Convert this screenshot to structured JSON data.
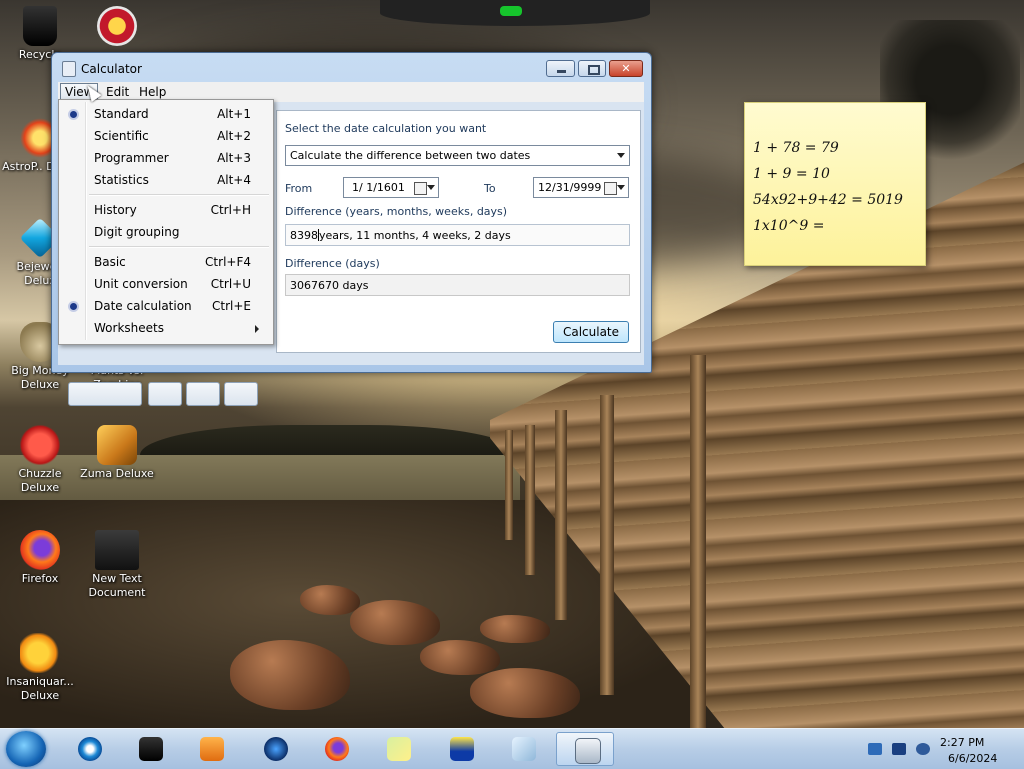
{
  "desktop": {
    "icons": [
      {
        "label": "Recycle"
      },
      {
        "label": "AstroP.. Delux"
      },
      {
        "label": "Bejewe.. Delux"
      },
      {
        "label": "Big Money Deluxe"
      },
      {
        "label": "Plants vs. Zombies"
      },
      {
        "label": "Chuzzle Deluxe"
      },
      {
        "label": "Zuma Deluxe"
      },
      {
        "label": "Firefox"
      },
      {
        "label": "New Text Document"
      },
      {
        "label": "Insaniquar... Deluxe"
      }
    ]
  },
  "sticky": {
    "lines": [
      "1 + 78 = 79",
      "1 + 9 = 10",
      "54x92+9+42 = 5019",
      "1x10^9 ="
    ]
  },
  "calculator": {
    "title": "Calculator",
    "menu": {
      "view": "View",
      "edit": "Edit",
      "help": "Help"
    },
    "view_menu": [
      {
        "label": "Standard",
        "shortcut": "Alt+1"
      },
      {
        "label": "Scientific",
        "shortcut": "Alt+2"
      },
      {
        "label": "Programmer",
        "shortcut": "Alt+3"
      },
      {
        "label": "Statistics",
        "shortcut": "Alt+4"
      },
      {
        "label": "History",
        "shortcut": "Ctrl+H"
      },
      {
        "label": "Digit grouping",
        "shortcut": ""
      },
      {
        "label": "Basic",
        "shortcut": "Ctrl+F4"
      },
      {
        "label": "Unit conversion",
        "shortcut": "Ctrl+U"
      },
      {
        "label": "Date calculation",
        "shortcut": "Ctrl+E"
      },
      {
        "label": "Worksheets",
        "shortcut": ""
      }
    ],
    "date_panel": {
      "prompt": "Select the date calculation you want",
      "mode": "Calculate the difference between two dates",
      "from_label": "From",
      "from_date": "1/ 1/1601",
      "to_label": "To",
      "to_date": "12/31/9999",
      "diff_label": "Difference (years, months, weeks, days)",
      "diff_value_a": "8398",
      "diff_value_b": "years, 11 months, 4 weeks, 2 days",
      "days_label": "Difference (days)",
      "days_value": "3067670 days",
      "calculate": "Calculate"
    }
  },
  "taskbar": {
    "time": "2:27 PM",
    "date": "6/6/2024"
  },
  "colors": {
    "taskbar": "#b7cde6",
    "window_frame": "#a9c6e8",
    "sticky": "#fdf29a",
    "menu_radio": "#1d3a8a"
  }
}
